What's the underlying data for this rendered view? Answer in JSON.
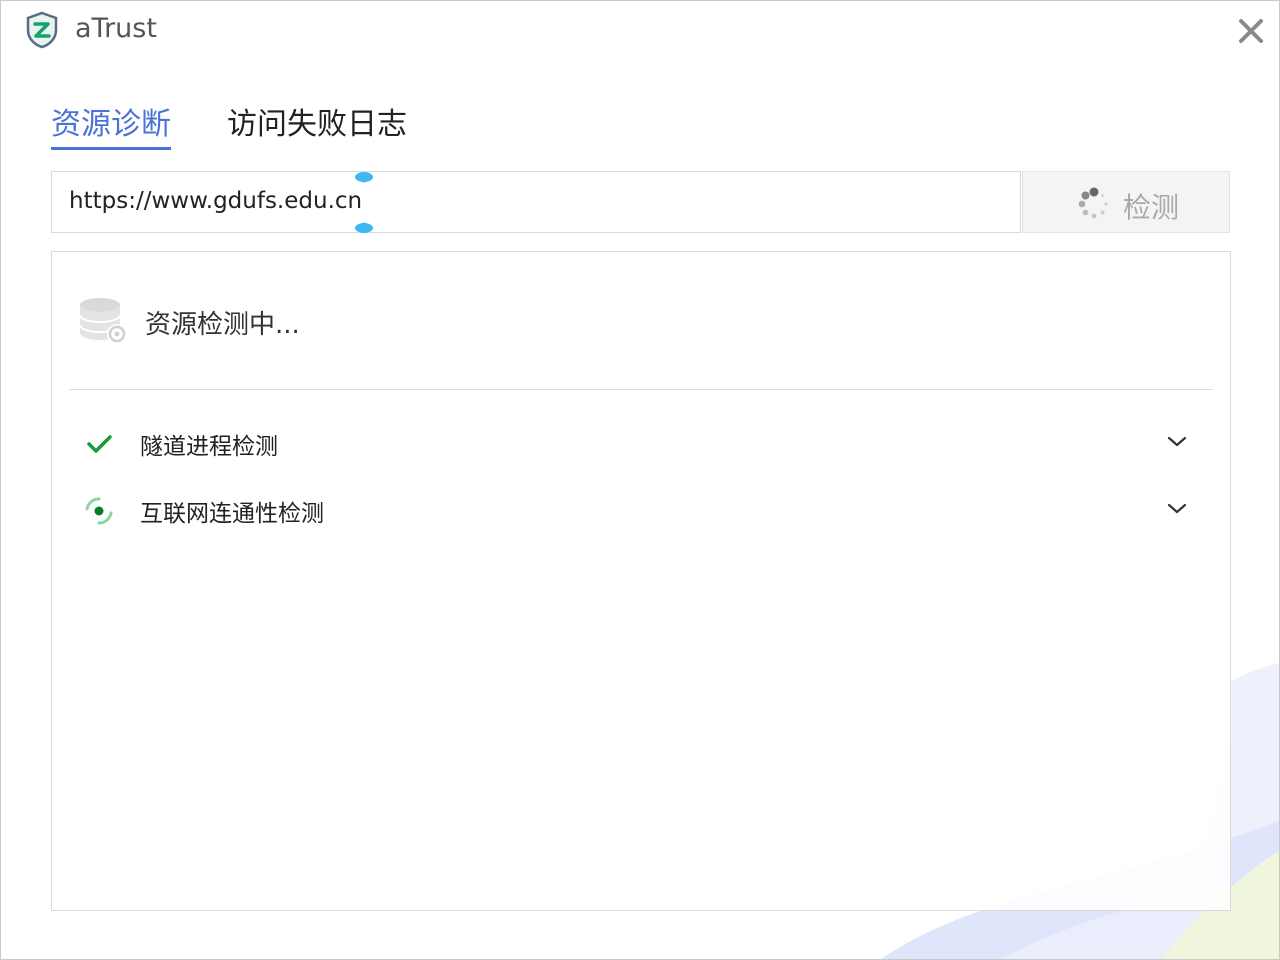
{
  "app": {
    "title": "aTrust",
    "brand_color": "#1aa06f",
    "logo_icon": "atrust-shield-logo-icon",
    "close_icon": "close-x-icon"
  },
  "tabs": [
    {
      "label": "资源诊断",
      "active": true
    },
    {
      "label": "访问失败日志",
      "active": false
    }
  ],
  "search": {
    "value": "https://www.gdufs.edu.cn",
    "button_label": "检测",
    "button_icon": "loading-spinner-icon",
    "button_state": "disabled"
  },
  "panel": {
    "status_text": "资源检测中...",
    "status_icon": "database-icon",
    "checks": [
      {
        "label": "隧道进程检测",
        "status": "passed",
        "status_icon": "checkmark-icon",
        "expand_icon": "chevron-down-icon"
      },
      {
        "label": "互联网连通性检测",
        "status": "in-progress",
        "status_icon": "progress-ring-icon",
        "expand_icon": "chevron-down-icon"
      }
    ]
  },
  "colors": {
    "accent": "#4a73d8",
    "success": "#1a9a3c",
    "handle": "#3fb7f0"
  }
}
